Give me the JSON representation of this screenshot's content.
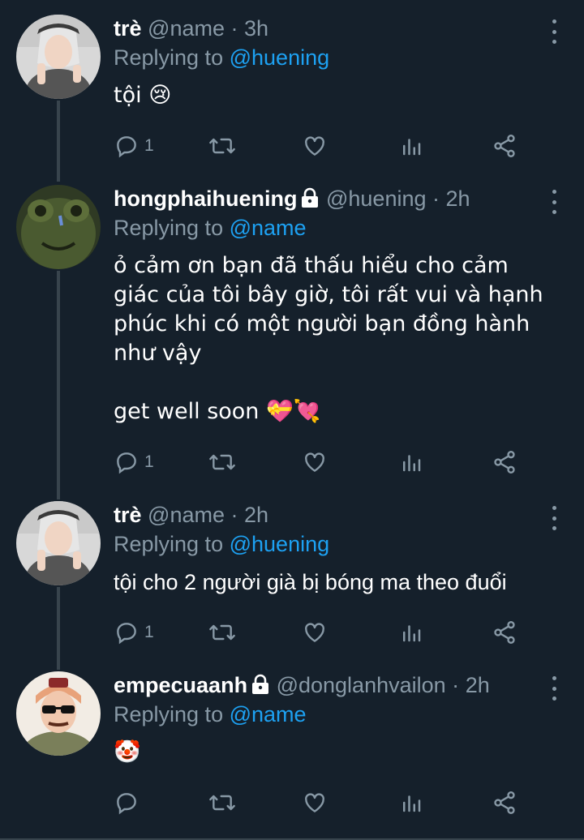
{
  "tweets": [
    {
      "name": "trè",
      "handle": "@name",
      "time": "3h",
      "locked": false,
      "replying_prefix": "Replying to",
      "replying_to": "@huening",
      "text": "tội 😢",
      "reply_count": "1",
      "avatar": "avatar-tre"
    },
    {
      "name": "hongphaihuening",
      "handle": "@huening",
      "time": "2h",
      "locked": true,
      "replying_prefix": "Replying to",
      "replying_to": "@name",
      "text": "ỏ cảm ơn bạn đã thấu hiểu cho cảm\ngiác của tôi bây giờ, tôi rất vui và hạnh\nphúc khi có một người bạn đồng hành\nnhư vậy\n\nget well soon 💝💘",
      "reply_count": "1",
      "avatar": "avatar-frog"
    },
    {
      "name": "trè",
      "handle": "@name",
      "time": "2h",
      "locked": false,
      "replying_prefix": "Replying to",
      "replying_to": "@huening",
      "text": "tội cho 2 người già bị bóng ma theo đuổi",
      "reply_count": "1",
      "avatar": "avatar-tre"
    },
    {
      "name": "empecuaanh",
      "handle": "@donglanhvailon",
      "time": "2h",
      "locked": true,
      "replying_prefix": "Replying to",
      "replying_to": "@name",
      "text": "🤡",
      "reply_count": "",
      "avatar": "avatar-sunglasses"
    }
  ],
  "separator": "·",
  "icons": [
    "reply-icon",
    "retweet-icon",
    "like-icon",
    "analytics-icon",
    "share-icon",
    "more-icon",
    "lock-icon"
  ],
  "colors": {
    "background": "#15202b",
    "muted": "#8899a6",
    "link": "#1da1f2",
    "line": "#38444d"
  }
}
